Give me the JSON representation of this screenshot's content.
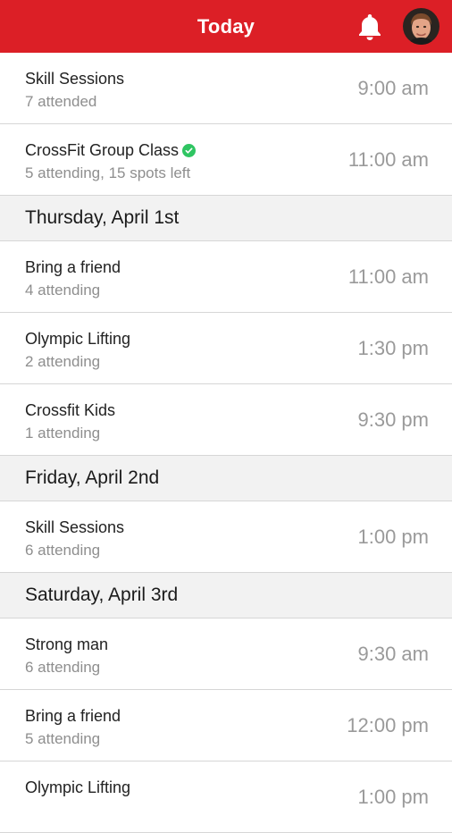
{
  "header": {
    "title": "Today",
    "bell_icon": "bell-icon",
    "avatar_icon": "user-avatar",
    "accent_color": "#dc1f26"
  },
  "groups": [
    {
      "day": "",
      "items": [
        {
          "title": "Skill Sessions",
          "subtitle": "7 attended",
          "time": "9:00 am",
          "verified": false
        },
        {
          "title": "CrossFit Group Class",
          "subtitle": "5 attending, 15 spots left",
          "time": "11:00 am",
          "verified": true
        }
      ]
    },
    {
      "day": "Thursday, April 1st",
      "items": [
        {
          "title": "Bring a friend",
          "subtitle": "4 attending",
          "time": "11:00 am",
          "verified": false
        },
        {
          "title": "Olympic Lifting",
          "subtitle": "2 attending",
          "time": "1:30 pm",
          "verified": false
        },
        {
          "title": "Crossfit Kids",
          "subtitle": "1 attending",
          "time": "9:30 pm",
          "verified": false
        }
      ]
    },
    {
      "day": "Friday, April 2nd",
      "items": [
        {
          "title": "Skill Sessions",
          "subtitle": "6 attending",
          "time": "1:00 pm",
          "verified": false
        }
      ]
    },
    {
      "day": "Saturday, April 3rd",
      "items": [
        {
          "title": "Strong man",
          "subtitle": "6 attending",
          "time": "9:30 am",
          "verified": false
        },
        {
          "title": "Bring a friend",
          "subtitle": "5 attending",
          "time": "12:00 pm",
          "verified": false
        },
        {
          "title": "Olympic Lifting",
          "subtitle": "",
          "time": "1:00 pm",
          "verified": false
        }
      ]
    }
  ]
}
